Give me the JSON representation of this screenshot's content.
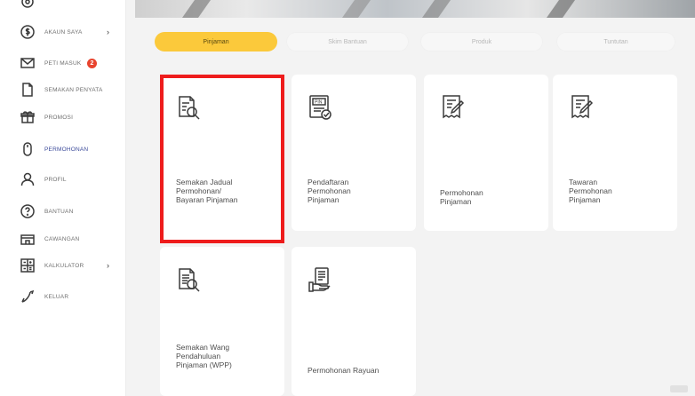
{
  "sidebar": {
    "items": [
      {
        "label": "",
        "icon": "settings-icon"
      },
      {
        "label": "AKAUN SAYA",
        "icon": "dollar-circle-icon",
        "chevron": "›"
      },
      {
        "label": "PETI MASUK",
        "icon": "mail-icon",
        "badge": "2"
      },
      {
        "label": "SEMAKAN PENYATA",
        "icon": "document-icon"
      },
      {
        "label": "PROMOSI",
        "icon": "gift-icon"
      },
      {
        "label": "PERMOHONAN",
        "icon": "mouse-icon"
      },
      {
        "label": "PROFIL",
        "icon": "user-icon"
      },
      {
        "label": "BANTUAN",
        "icon": "help-icon"
      },
      {
        "label": "CAWANGAN",
        "icon": "branch-icon"
      },
      {
        "label": "KALKULATOR",
        "icon": "calculator-icon",
        "chevron": "›"
      },
      {
        "label": "KELUAR",
        "icon": "logout-icon"
      }
    ]
  },
  "tabs": [
    {
      "label": "Pinjaman"
    },
    {
      "label": "Skim Bantuan"
    },
    {
      "label": "Produk"
    },
    {
      "label": "Tuntutan"
    }
  ],
  "cards": [
    {
      "title": "Semakan Jadual\nPermohonan/\nBayaran Pinjaman",
      "icon": "document-search-icon"
    },
    {
      "title": "Pendaftaran\nPermohonan\nPinjaman",
      "icon": "pin-document-icon",
      "icon_text": "PIN"
    },
    {
      "title": "Permohonan\nPinjaman",
      "icon": "receipt-pen-icon"
    },
    {
      "title": "Tawaran\nPermohonan\nPinjaman",
      "icon": "receipt-pen-icon"
    },
    {
      "title": "Semakan Wang\nPendahuluan\nPinjaman (WPP)",
      "icon": "report-search-icon"
    },
    {
      "title": "Permohonan Rayuan",
      "icon": "hand-document-icon"
    }
  ],
  "colors": {
    "accent": "#fbc93b",
    "highlight": "#ee1c1c",
    "badge": "#e8442e",
    "active_nav": "#3b4a9a"
  }
}
